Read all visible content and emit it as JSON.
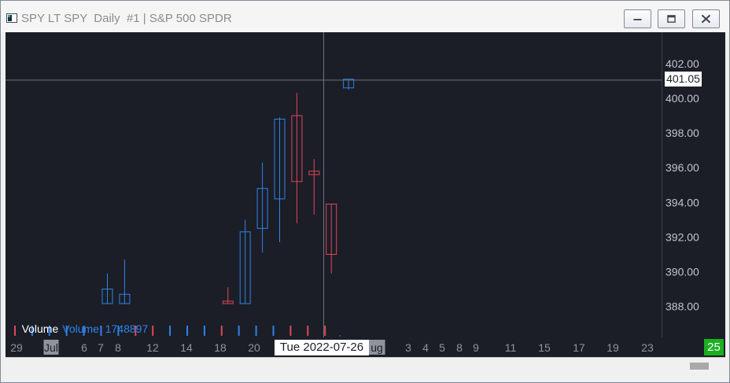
{
  "window": {
    "title": "SPY LT SPY  Daily  #1 | S&P 500 SPDR"
  },
  "colors": {
    "background": "#1b1e27",
    "up": "#2f82e8",
    "down": "#e0455a",
    "axis_text": "#c0c4cc",
    "grid_hidden": "#5a5e66"
  },
  "crosshair": {
    "price": "401.05",
    "date": "Tue 2022-07-26"
  },
  "volume": {
    "label": "Volume",
    "value_text": "Volume: 1748897"
  },
  "green_badge": "25",
  "chart_data": {
    "type": "candlestick",
    "title": "",
    "ylim": [
      387.6,
      403.4
    ],
    "y_ticks": [
      "402.00",
      "400.00",
      "398.00",
      "396.00",
      "394.00",
      "392.00",
      "390.00",
      "388.00"
    ],
    "x_tick_labels": [
      "29",
      "Jul",
      "6",
      "7",
      "8",
      "12",
      "14",
      "18",
      "20",
      "ug",
      "3",
      "4",
      "5",
      "8",
      "9",
      "11",
      "15",
      "17",
      "19",
      "23"
    ],
    "candles": [
      {
        "index": 5,
        "open": 387.6,
        "close": 389.0,
        "high": 389.9,
        "low": 387.6,
        "direction": "up"
      },
      {
        "index": 6,
        "open": 387.6,
        "close": 388.7,
        "high": 390.7,
        "low": 387.6,
        "direction": "up"
      },
      {
        "index": 12,
        "open": 388.3,
        "close": 387.6,
        "high": 389.1,
        "low": 387.6,
        "direction": "down"
      },
      {
        "index": 13,
        "open": 387.8,
        "close": 392.3,
        "high": 393.0,
        "low": 387.8,
        "direction": "up"
      },
      {
        "index": 14,
        "open": 392.5,
        "close": 394.8,
        "high": 396.3,
        "low": 391.1,
        "direction": "up"
      },
      {
        "index": 15,
        "open": 394.2,
        "close": 398.8,
        "high": 398.9,
        "low": 391.7,
        "direction": "up"
      },
      {
        "index": 16,
        "open": 399.0,
        "close": 395.2,
        "high": 400.3,
        "low": 392.8,
        "direction": "down"
      },
      {
        "index": 17,
        "open": 395.8,
        "close": 395.6,
        "high": 396.5,
        "low": 393.3,
        "direction": "down"
      },
      {
        "index": 18,
        "open": 393.9,
        "close": 391.0,
        "high": 393.9,
        "low": 389.9,
        "direction": "down"
      },
      {
        "index": 19,
        "open": 400.6,
        "close": 401.1,
        "high": 401.1,
        "low": 400.5,
        "direction": "up"
      }
    ],
    "volume_ticks": [
      {
        "index": 0,
        "direction": "down"
      },
      {
        "index": 1,
        "direction": "up"
      },
      {
        "index": 2,
        "direction": "up"
      },
      {
        "index": 3,
        "direction": "up"
      },
      {
        "index": 4,
        "direction": "up"
      },
      {
        "index": 5,
        "direction": "up"
      },
      {
        "index": 6,
        "direction": "up"
      },
      {
        "index": 7,
        "direction": "down"
      },
      {
        "index": 8,
        "direction": "down"
      },
      {
        "index": 9,
        "direction": "up"
      },
      {
        "index": 10,
        "direction": "up"
      },
      {
        "index": 11,
        "direction": "up"
      },
      {
        "index": 12,
        "direction": "down"
      },
      {
        "index": 13,
        "direction": "up"
      },
      {
        "index": 14,
        "direction": "up"
      },
      {
        "index": 15,
        "direction": "up"
      },
      {
        "index": 16,
        "direction": "down"
      },
      {
        "index": 17,
        "direction": "down"
      },
      {
        "index": 18,
        "direction": "down"
      }
    ]
  }
}
